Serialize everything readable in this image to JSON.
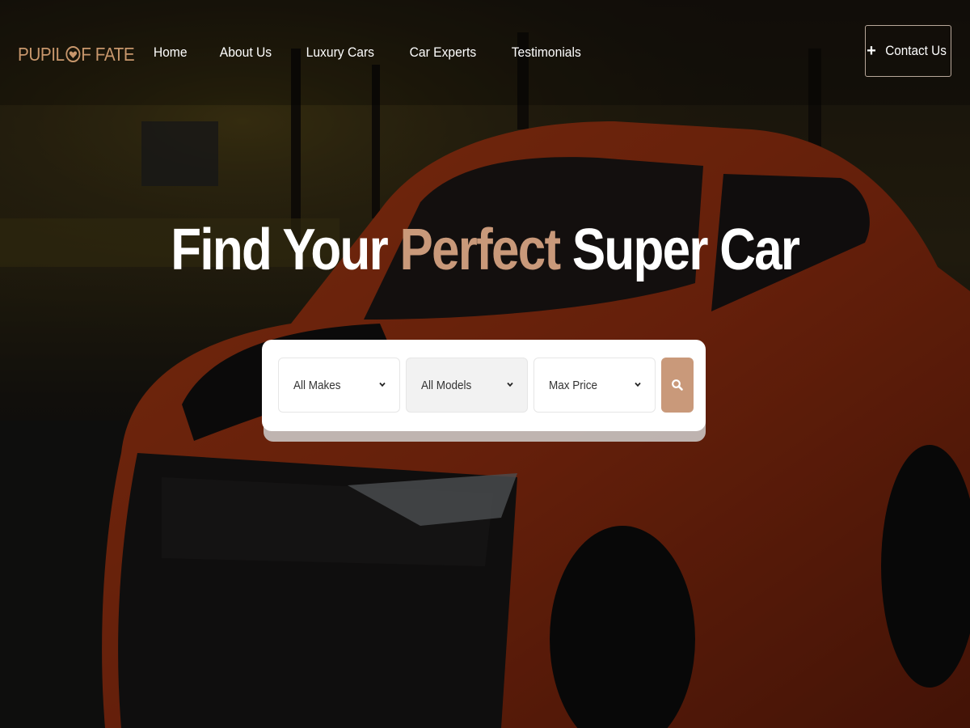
{
  "brand": {
    "name_part1": "PUPIL",
    "name_part2": "F FATE",
    "logo_icon": "heart-o-logo-icon",
    "color": "#c8976c"
  },
  "nav": {
    "items": [
      {
        "label": "Home"
      },
      {
        "label": "About Us"
      },
      {
        "label": "Luxury Cars"
      },
      {
        "label": "Car Experts"
      },
      {
        "label": "Testimonials"
      }
    ],
    "contact": {
      "label": "Contact Us",
      "icon": "plus-icon"
    }
  },
  "hero": {
    "title_part1": "Find Your ",
    "title_accent": "Perfect",
    "title_part2": " Super Car",
    "accent_color": "#c9997a"
  },
  "search": {
    "makes": {
      "value": "All Makes",
      "icon": "chevron-down-icon"
    },
    "models": {
      "value": "All Models",
      "icon": "chevron-down-icon"
    },
    "price": {
      "value": "Max Price",
      "icon": "chevron-down-icon"
    },
    "button": {
      "icon": "search-icon",
      "color": "#c9997a"
    }
  },
  "background": {
    "description_colors": {
      "car": "#c8431a",
      "overlay": "#000000"
    }
  }
}
